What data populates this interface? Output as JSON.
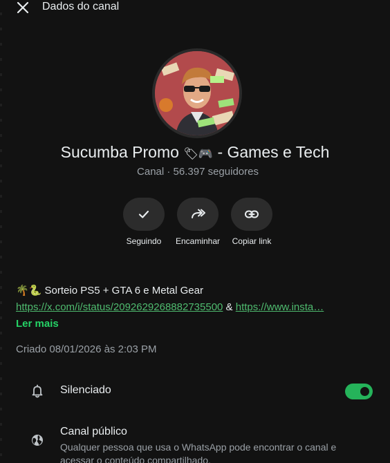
{
  "header": {
    "title": "Dados do canal"
  },
  "channel": {
    "name": "Sucumba Promo ",
    "name_emoji": "🏷🎮",
    "name_suffix": " - Games e Tech",
    "subtitle": "Canal · 56.397 seguidores"
  },
  "actions": [
    {
      "label": "Seguindo",
      "icon": "check-icon"
    },
    {
      "label": "Encaminhar",
      "icon": "forward-icon"
    },
    {
      "label": "Copiar link",
      "icon": "link-icon"
    }
  ],
  "description": {
    "emoji": "🌴🐍",
    "text": " Sorteio PS5 + GTA 6 e Metal Gear",
    "link1": "https://x.com/i/status/2092629268882735500",
    "separator": " & ",
    "link2": "https://www.insta…",
    "read_more": "Ler mais"
  },
  "created": "Criado 08/01/2026 às 2:03 PM",
  "settings": {
    "muted": {
      "label": "Silenciado",
      "enabled": true,
      "toggle_color": "#25b35a",
      "icon": "bell-icon"
    },
    "public": {
      "label": "Canal público",
      "description": "Qualquer pessoa que usa o WhatsApp pode encontrar o canal e acessar o conteúdo compartilhado.",
      "icon": "globe-icon"
    }
  },
  "colors": {
    "background": "#121212",
    "accent": "#25d366",
    "link": "#4fbb6f",
    "muted_text": "#9aa0a6"
  }
}
